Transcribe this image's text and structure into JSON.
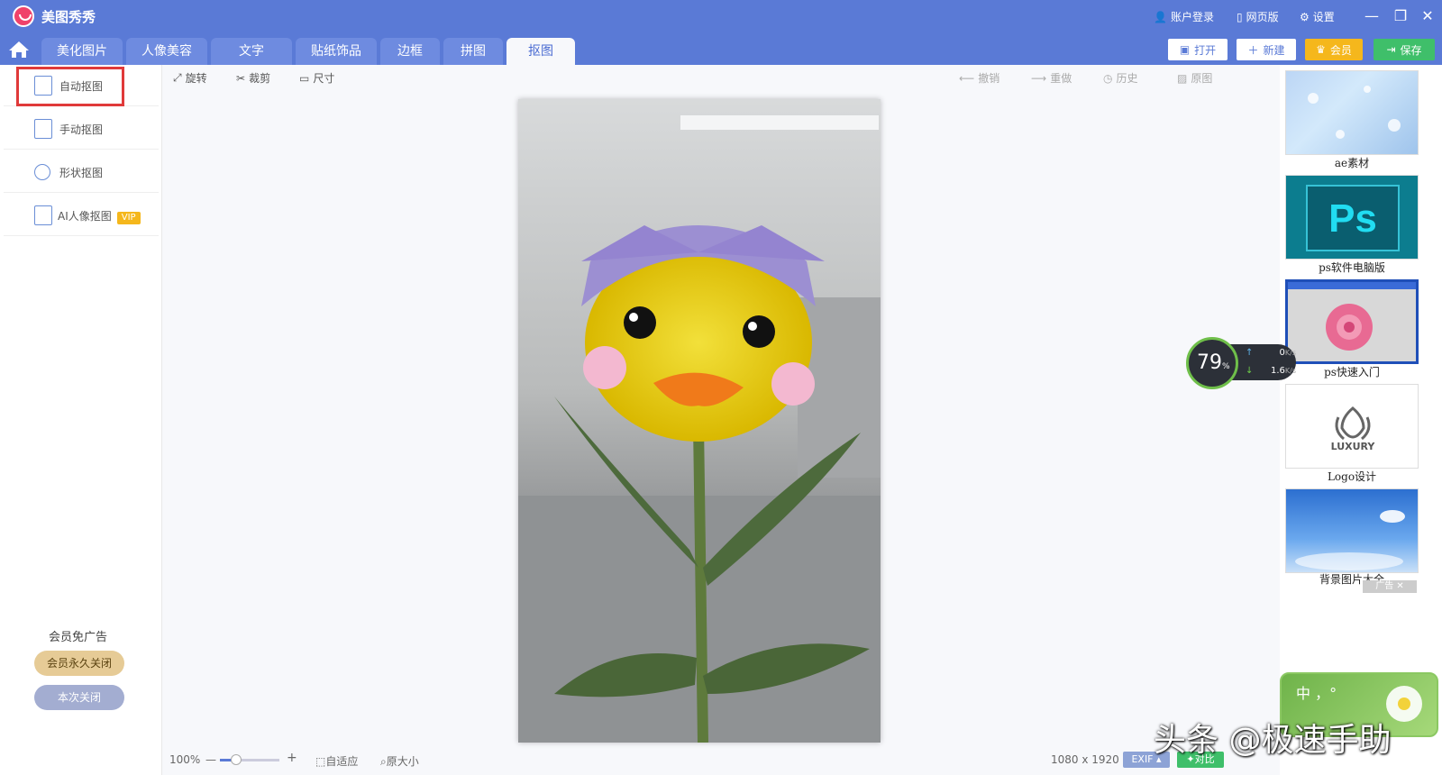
{
  "app": {
    "title": "美图秀秀"
  },
  "titlebar": {
    "login": "账户登录",
    "web": "网页版",
    "settings": "设置"
  },
  "tabs": [
    "美化图片",
    "人像美容",
    "文字",
    "贴纸饰品",
    "边框",
    "拼图",
    "抠图"
  ],
  "actions": {
    "open": "打开",
    "new": "新建",
    "member": "会员",
    "save": "保存"
  },
  "left_panel": {
    "items": [
      {
        "label": "自动抠图"
      },
      {
        "label": "手动抠图"
      },
      {
        "label": "形状抠图"
      },
      {
        "label": "AI人像抠图",
        "badge": "VIP"
      }
    ],
    "ad_title": "会员免广告",
    "permanent_close": "会员永久关闭",
    "close_once": "本次关闭"
  },
  "toolbar": {
    "rotate": "旋转",
    "crop": "裁剪",
    "size": "尺寸",
    "undo": "撤销",
    "redo": "重做",
    "history": "历史",
    "original": "原图"
  },
  "status": {
    "zoom": "100%",
    "fit": "自适应",
    "actual": "原大小",
    "dimensions": "1080 x 1920",
    "exif": "EXIF",
    "compare": "对比"
  },
  "right_panel": {
    "items": [
      "ae素材",
      "ps软件电脑版",
      "ps快速入门",
      "Logo设计",
      "背景图片大全"
    ],
    "ad_tag": "广告",
    "ps_text": "Ps",
    "logo_text": "LUXURY"
  },
  "speed": {
    "cpu": "79",
    "unit": "%",
    "up": "0",
    "down": "1.6",
    "rate_unit": "K/s"
  },
  "ime": {
    "text": "中 ，°"
  },
  "watermark": "头条 @极速手助",
  "colors": {
    "primary": "#5a7ad6",
    "accent_red": "#e03a3a",
    "green": "#3fbf6a",
    "gold": "#f5b71c"
  }
}
